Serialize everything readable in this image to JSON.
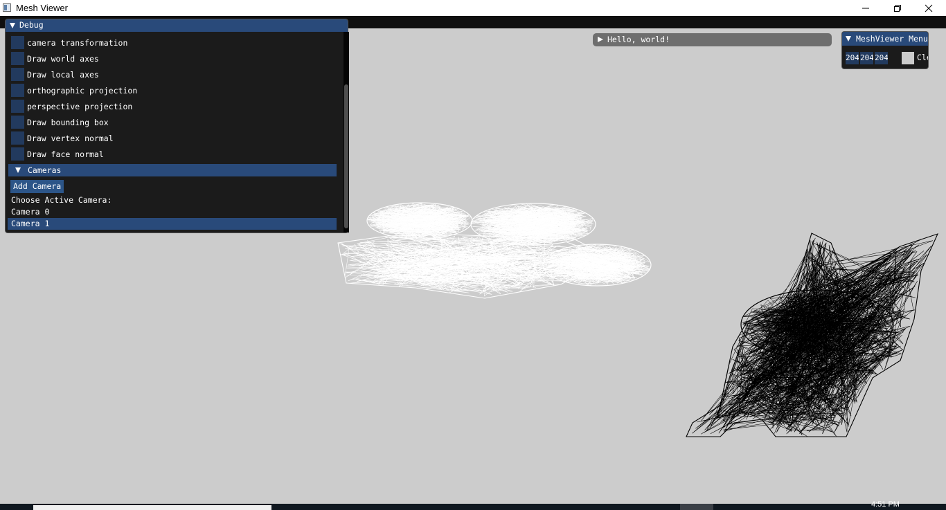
{
  "window": {
    "title": "Mesh Viewer"
  },
  "debug": {
    "title": "Debug",
    "options": [
      {
        "label": "camera transformation",
        "checked": false
      },
      {
        "label": "Draw world axes",
        "checked": false
      },
      {
        "label": "Draw local axes",
        "checked": false
      },
      {
        "label": "orthographic projection",
        "checked": false
      },
      {
        "label": "perspective projection",
        "checked": false
      },
      {
        "label": "Draw bounding box",
        "checked": false
      },
      {
        "label": "Draw vertex normal",
        "checked": false
      },
      {
        "label": "Draw face normal",
        "checked": false
      }
    ],
    "cameras_header": "Cameras",
    "add_camera_label": "Add Camera",
    "choose_label": "Choose Active Camera:",
    "cameras": [
      "Camera 0",
      "Camera 1"
    ],
    "selected_camera": "Camera 1"
  },
  "hello": {
    "label": "Hello, world!"
  },
  "menu": {
    "title": "MeshViewer Menu",
    "color_fields": [
      "204",
      "204",
      "204"
    ],
    "clear_color": "#cccccc",
    "clear_label": "Clear"
  },
  "taskbar": {
    "time": "4:51 PM"
  },
  "colors": {
    "accent": "#294a7a",
    "checkbox": "#223a5e",
    "viewport": "#cccccc"
  }
}
